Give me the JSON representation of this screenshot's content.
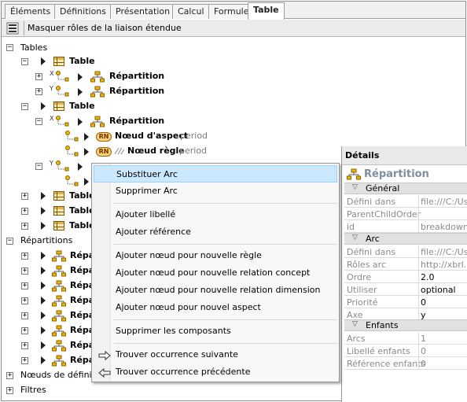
{
  "tabs": [
    {
      "label": "Éléments"
    },
    {
      "label": "Définitions"
    },
    {
      "label": "Présentation"
    },
    {
      "label": "Calcul"
    },
    {
      "label": "Formule"
    },
    {
      "label": "Table"
    }
  ],
  "toolbar": {
    "label": "Masquer rôles de la liaison étendue"
  },
  "tree": {
    "tables_label": "Tables",
    "table_label": "Table",
    "repartition_label": "Répartition",
    "aspect_label": "Nœud d'aspect",
    "aspect_suffix": "period",
    "rule_label": "Nœud règle",
    "rule_suffix": "period",
    "rn_badge": "RN",
    "repartitions_label": "Répartitions",
    "repartition_short": "Répa",
    "nodes_def_label": "Nœuds de définiti",
    "filters_label": "Filtres",
    "x_letter": "X",
    "y_letter": "Y"
  },
  "menu": {
    "items": [
      {
        "label": "Substituer Arc"
      },
      {
        "label": "Supprimer Arc"
      },
      {
        "label": "Ajouter libellé"
      },
      {
        "label": "Ajouter référence"
      },
      {
        "label": "Ajouter nœud pour nouvelle règle"
      },
      {
        "label": "Ajouter nœud pour nouvelle relation concept"
      },
      {
        "label": "Ajouter nœud pour nouvelle relation dimension"
      },
      {
        "label": "Ajouter nœud pour nouvel aspect"
      },
      {
        "label": "Supprimer les composants"
      },
      {
        "label": "Trouver occurrence suivante"
      },
      {
        "label": "Trouver occurrence précédente"
      }
    ]
  },
  "details": {
    "title": "Détails",
    "name": "Répartition",
    "sections": {
      "general": "Général",
      "arc": "Arc",
      "children": "Enfants"
    },
    "general": [
      {
        "key": "Défini dans",
        "value": "file:///C:/Us"
      },
      {
        "key": "ParentChildOrder",
        "value": ""
      },
      {
        "key": "id",
        "value": "breakdown"
      }
    ],
    "arc": [
      {
        "key": "Défini dans",
        "value": "file:///C:/Us"
      },
      {
        "key": "Rôles arc",
        "value": "http://xbrl."
      },
      {
        "key": "Ordre",
        "value": "2.0"
      },
      {
        "key": "Utiliser",
        "value": "optional"
      },
      {
        "key": "Priorité",
        "value": "0"
      },
      {
        "key": "Axe",
        "value": "y"
      }
    ],
    "children": [
      {
        "key": "Arcs",
        "value": "1"
      },
      {
        "key": "Libellé enfants",
        "value": "0"
      },
      {
        "key": "Référence enfants",
        "value": "0"
      }
    ]
  },
  "colors": {
    "accent": "#cce8ff",
    "tab_bg": "#f0f0f0"
  }
}
